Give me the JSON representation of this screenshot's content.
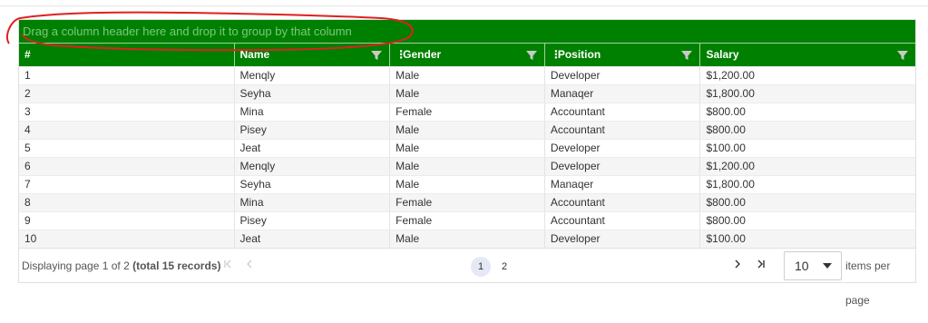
{
  "grid": {
    "group_panel_text": "Drag a column header here and drop it to group by that column",
    "columns": [
      {
        "label": "#",
        "filter": false,
        "drag": false
      },
      {
        "label": "Name",
        "filter": true,
        "drag": false
      },
      {
        "label": "Gender",
        "filter": true,
        "drag": true
      },
      {
        "label": "Position",
        "filter": true,
        "drag": true
      },
      {
        "label": "Salary",
        "filter": true,
        "drag": false
      }
    ],
    "rows": [
      [
        "1",
        "Menqly",
        "Male",
        "Developer",
        "$1,200.00"
      ],
      [
        "2",
        "Seyha",
        "Male",
        "Manaqer",
        "$1,800.00"
      ],
      [
        "3",
        "Mina",
        "Female",
        "Accountant",
        "$800.00"
      ],
      [
        "4",
        "Pisey",
        "Male",
        "Accountant",
        "$800.00"
      ],
      [
        "5",
        "Jeat",
        "Male",
        "Developer",
        "$100.00"
      ],
      [
        "6",
        "Menqly",
        "Male",
        "Developer",
        "$1,200.00"
      ],
      [
        "7",
        "Seyha",
        "Male",
        "Manaqer",
        "$1,800.00"
      ],
      [
        "8",
        "Mina",
        "Female",
        "Accountant",
        "$800.00"
      ],
      [
        "9",
        "Pisey",
        "Female",
        "Accountant",
        "$800.00"
      ],
      [
        "10",
        "Jeat",
        "Male",
        "Developer",
        "$100.00"
      ]
    ]
  },
  "pager": {
    "info_prefix": "Displaying page 1 of 2 ",
    "info_total": "(total 15 records)",
    "pages": [
      "1",
      "2"
    ],
    "current_page": "1",
    "first_icon": "first-page-icon",
    "prev_icon": "previous-page-icon",
    "next_icon": "next-page-icon",
    "last_icon": "last-page-icon",
    "page_size": "10",
    "items_per_page_label": "items per page"
  },
  "colors": {
    "header_green": "#008000",
    "annotation_red": "#e02020"
  }
}
